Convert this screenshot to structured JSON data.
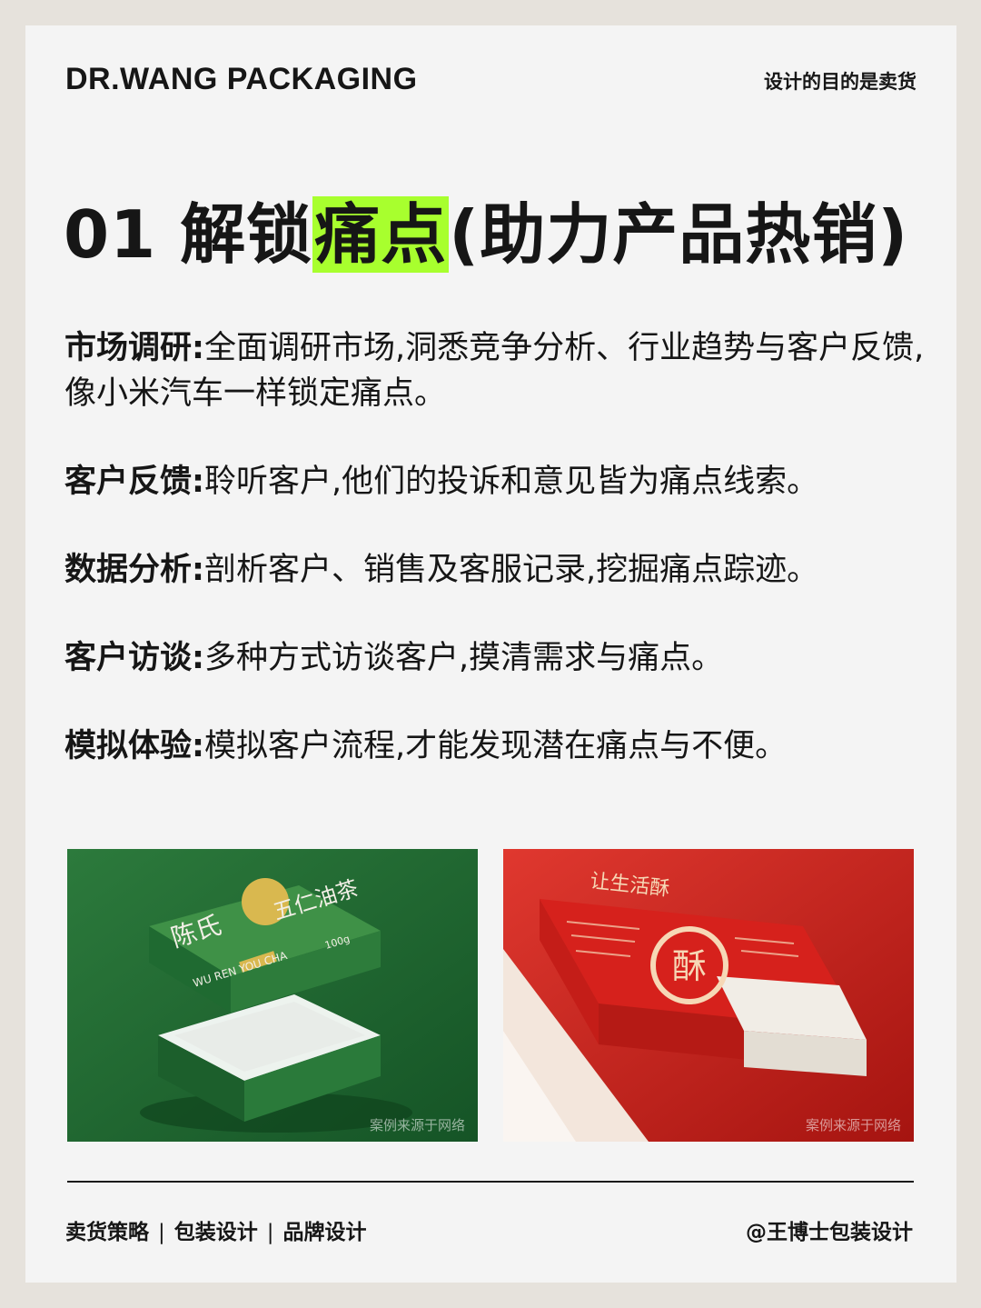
{
  "header": {
    "brand": "DR.WANG PACKAGING",
    "slogan": "设计的目的是卖货"
  },
  "title": {
    "prefix": "01 解锁",
    "highlight": "痛点",
    "suffix": "(助力产品热销)"
  },
  "items": [
    {
      "label": "市场调研:",
      "text": "全面调研市场,洞悉竞争分析、行业趋势与客户反馈,像小米汽车一样锁定痛点。"
    },
    {
      "label": "客户反馈:",
      "text": "聆听客户,他们的投诉和意见皆为痛点线索。"
    },
    {
      "label": "数据分析:",
      "text": "剖析客户、销售及客服记录,挖掘痛点踪迹。"
    },
    {
      "label": "客户访谈:",
      "text": "多种方式访谈客户,摸清需求与痛点。"
    },
    {
      "label": "模拟体验:",
      "text": "模拟客户流程,才能发现潜在痛点与不便。"
    }
  ],
  "photos": [
    {
      "box_title_lines": [
        "陈氏",
        "五仁油茶"
      ],
      "box_subtitle": "WU REN YOU CHA",
      "box_weight": "100g",
      "watermark": "案例来源于网络"
    },
    {
      "box_stamp": "酥",
      "box_label": "让生活酥",
      "watermark": "案例来源于网络"
    }
  ],
  "footer": {
    "tags": [
      "卖货策略",
      "包装设计",
      "品牌设计"
    ],
    "separator": "|",
    "handle": "@王博士包装设计"
  },
  "colors": {
    "highlight": "#a8ff2e",
    "background": "#f4f4f4",
    "frame": "#e6e2dc"
  }
}
